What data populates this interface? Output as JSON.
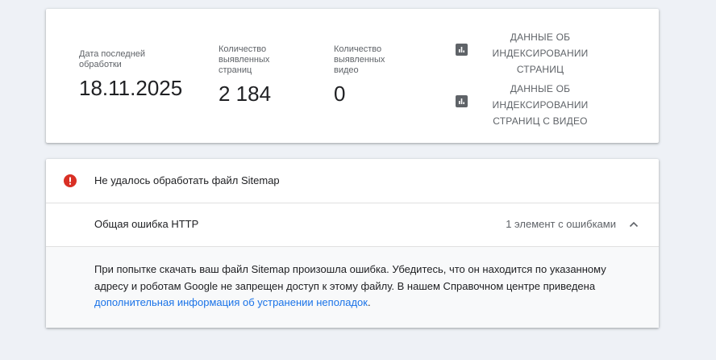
{
  "stats": {
    "last_processed": {
      "label": "Дата последней обработки",
      "value": "18.11.2025"
    },
    "pages_found": {
      "label": "Количество выявленных страниц",
      "value": "2 184"
    },
    "videos_found": {
      "label": "Количество выявленных видео",
      "value": "0"
    }
  },
  "reports": {
    "pages": {
      "icon": "bar-chart-icon",
      "label": "ДАННЫЕ ОБ ИНДЕКСИРОВАНИИ СТРАНИЦ"
    },
    "video": {
      "icon": "bar-chart-icon",
      "label": "ДАННЫЕ ОБ ИНДЕКСИРОВАНИИ СТРАНИЦ С ВИДЕО"
    }
  },
  "error": {
    "icon": "error-icon",
    "title": "Не удалось обработать файл Sitemap",
    "item": {
      "title": "Общая ошибка HTTP",
      "count": "1 элемент с ошибками",
      "chevron": "chevron-up-icon"
    },
    "details": {
      "text": "При попытке скачать ваш файл Sitemap произошла ошибка. Убедитесь, что он находится по указанному адресу и роботам Google не запрещен доступ к этому файлу. В нашем Справочном центре приведена ",
      "link": "дополнительная информация об устранении неполадок",
      "end": "."
    }
  },
  "colors": {
    "background": "#eef1f6",
    "error_red": "#d93025",
    "link_blue": "#1a73e8",
    "muted_text": "#5f6368"
  }
}
